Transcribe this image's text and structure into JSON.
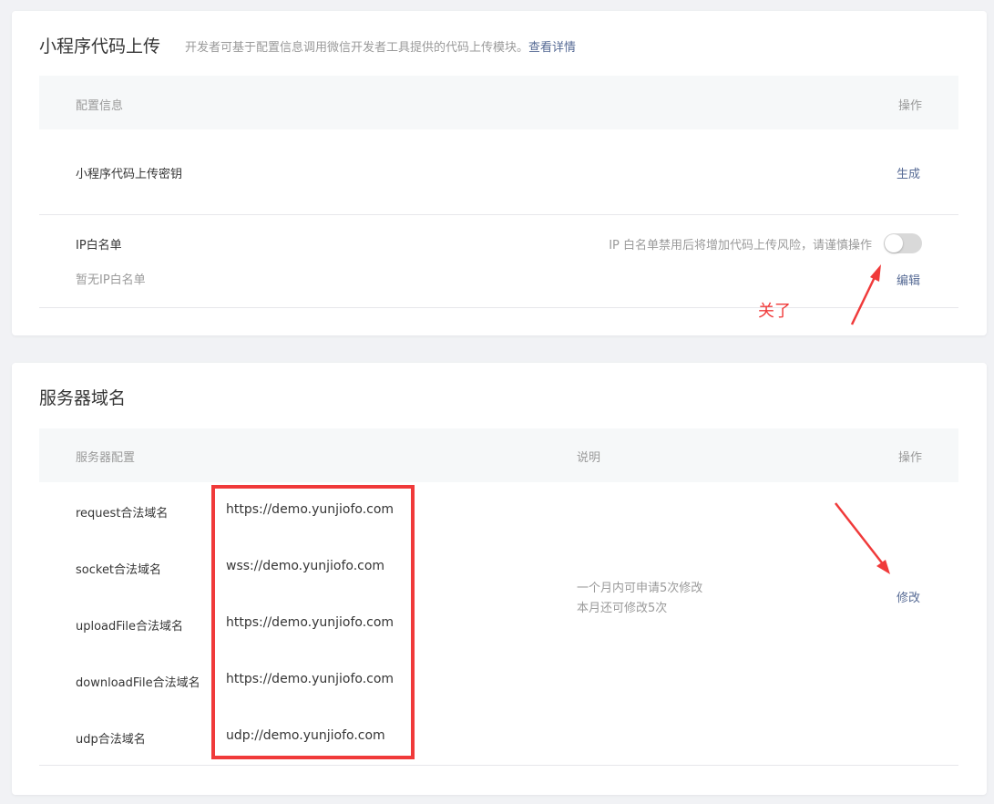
{
  "upload": {
    "title": "小程序代码上传",
    "desc": "开发者可基于配置信息调用微信开发者工具提供的代码上传模块。",
    "link": "查看详情",
    "col_config": "配置信息",
    "col_action": "操作",
    "key_label": "小程序代码上传密钥",
    "key_action": "生成",
    "ip_label": "IP白名单",
    "ip_empty": "暂无IP白名单",
    "ip_hint": "IP 白名单禁用后将增加代码上传风险，请谨慎操作",
    "ip_toggle_on": false,
    "ip_action": "编辑"
  },
  "annotation": {
    "text": "关了",
    "color": "#f03a3a"
  },
  "server": {
    "title": "服务器域名",
    "col_config": "服务器配置",
    "col_desc": "说明",
    "col_action": "操作",
    "rows": [
      {
        "label": "request合法域名",
        "value": "https://demo.yunjiofo.com"
      },
      {
        "label": "socket合法域名",
        "value": "wss://demo.yunjiofo.com"
      },
      {
        "label": "uploadFile合法域名",
        "value": "https://demo.yunjiofo.com"
      },
      {
        "label": "downloadFile合法域名",
        "value": "https://demo.yunjiofo.com"
      },
      {
        "label": "udp合法域名",
        "value": "udp://demo.yunjiofo.com"
      }
    ],
    "desc_line1": "一个月内可申请5次修改",
    "desc_line2": "本月还可修改5次",
    "action": "修改"
  }
}
